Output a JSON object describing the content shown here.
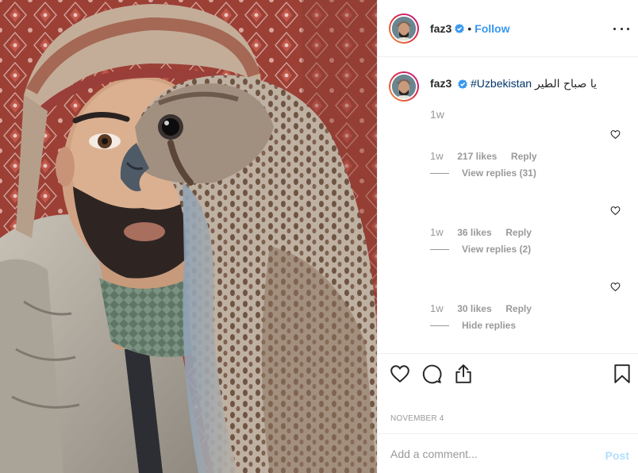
{
  "post": {
    "username": "faz3",
    "separator": "•",
    "follow_label": "Follow",
    "more_icon": "more-horizontal-icon",
    "verified_color": "#3897f0"
  },
  "caption": {
    "username": "faz3",
    "hashtag": "#Uzbekistan",
    "text": "يا صباح الطير",
    "time": "1w"
  },
  "comments": [
    {
      "time": "1w",
      "likes": "217 likes",
      "reply": "Reply",
      "replies_label": "View replies (31)"
    },
    {
      "time": "1w",
      "likes": "36 likes",
      "reply": "Reply",
      "replies_label": "View replies (2)"
    },
    {
      "time": "1w",
      "likes": "30 likes",
      "reply": "Reply",
      "replies_label": "Hide replies"
    }
  ],
  "actions": {
    "like_icon": "heart-icon",
    "comment_icon": "comment-icon",
    "share_icon": "share-icon",
    "save_icon": "bookmark-icon"
  },
  "date": "NOVEMBER 4",
  "add_comment": {
    "placeholder": "Add a comment...",
    "post_label": "Post"
  },
  "colors": {
    "accent": "#3897f0",
    "hashtag": "#003569",
    "muted": "#999999",
    "post_disabled": "#b2dffc"
  }
}
